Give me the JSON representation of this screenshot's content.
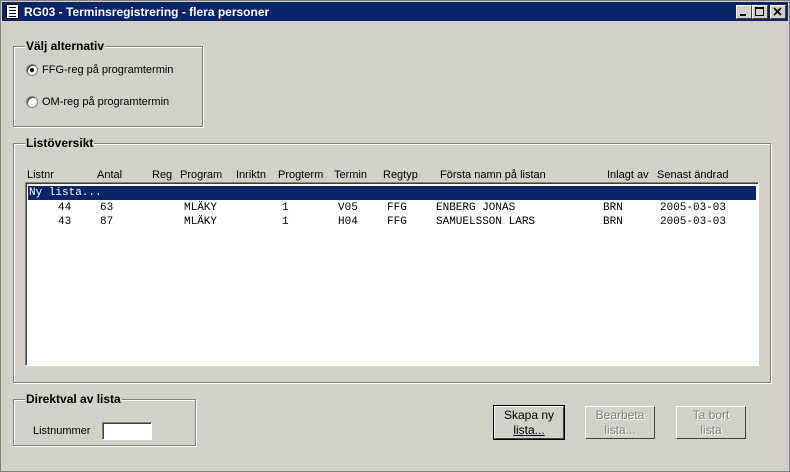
{
  "window": {
    "title": "RG03 - Terminsregistrering - flera personer",
    "controls": [
      "minimize-icon",
      "maximize-icon",
      "close-icon"
    ]
  },
  "alternatives": {
    "legend": "Välj alternativ",
    "options": [
      {
        "label": "FFG-reg på programtermin",
        "checked": true
      },
      {
        "label": "OM-reg på programtermin",
        "checked": false
      }
    ]
  },
  "overview": {
    "legend": "Listöversikt",
    "columns": [
      "Listnr",
      "Antal",
      "Reg",
      "Program",
      "Inriktn",
      "Progterm",
      "Termin",
      "Regtyp",
      "Första namn på listan",
      "Inlagt av",
      "Senast ändrad"
    ],
    "new_list_label": "Ny lista...",
    "rows": [
      {
        "listnr": "44",
        "antal": "63",
        "reg": "",
        "program": "MLÄKY",
        "inriktn": "",
        "progterm": "1",
        "termin": "V05",
        "regtyp": "FFG",
        "forsta_namn": "ENBERG JONAS",
        "inlagt_av": "BRN",
        "senast_andrad": "2005-03-03"
      },
      {
        "listnr": "43",
        "antal": "87",
        "reg": "",
        "program": "MLÄKY",
        "inriktn": "",
        "progterm": "1",
        "termin": "H04",
        "regtyp": "FFG",
        "forsta_namn": "SAMUELSSON LARS",
        "inlagt_av": "BRN",
        "senast_andrad": "2005-03-03"
      }
    ]
  },
  "direct": {
    "legend": "Direktval av lista",
    "field_label": "Listnummer",
    "field_value": ""
  },
  "buttons": {
    "create_line1": "Skapa ny",
    "create_line2": "lista...",
    "edit_line1": "Bearbeta",
    "edit_line2": "lista...",
    "delete_line1": "Ta bort",
    "delete_line2": "lista"
  }
}
